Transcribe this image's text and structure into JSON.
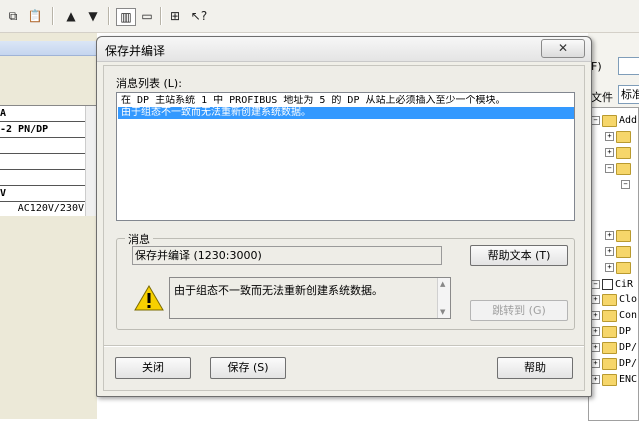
{
  "background": {
    "left_pane": {
      "rows": [
        "A",
        "-2 PN/DP",
        "",
        "",
        "",
        "",
        "V",
        "AC120V/230V"
      ]
    },
    "right_pane": {
      "field_paren": "F)",
      "label_file": "文件",
      "field_value": "标准",
      "tree_items": [
        "Add",
        "",
        "",
        "",
        "",
        "",
        "CiR",
        "Clo",
        "Con",
        "DP",
        "DP/",
        "DP/",
        "ENC"
      ]
    }
  },
  "dialog": {
    "title": "保存并编译",
    "close_symbol": "✕",
    "list_label": "消息列表 (L):",
    "messages": [
      "在 DP 主站系统 1 中 PROFIBUS 地址为 5 的 DP 从站上必须插入至少一个模块。",
      "由于组态不一致而无法重新创建系统数据。"
    ],
    "selected_index": 1,
    "group": {
      "legend": "消息",
      "code_text": "保存并编译 (1230:3000)",
      "message_text": "由于组态不一致而无法重新创建系统数据。",
      "help_button": "帮助文本 (T)",
      "jump_button": "跳转到 (G)"
    },
    "buttons": {
      "close": "关闭",
      "save": "保存 (S)",
      "help": "帮助"
    }
  },
  "colors": {
    "selection": "#3399ff",
    "warning_yellow": "#f7d000"
  }
}
